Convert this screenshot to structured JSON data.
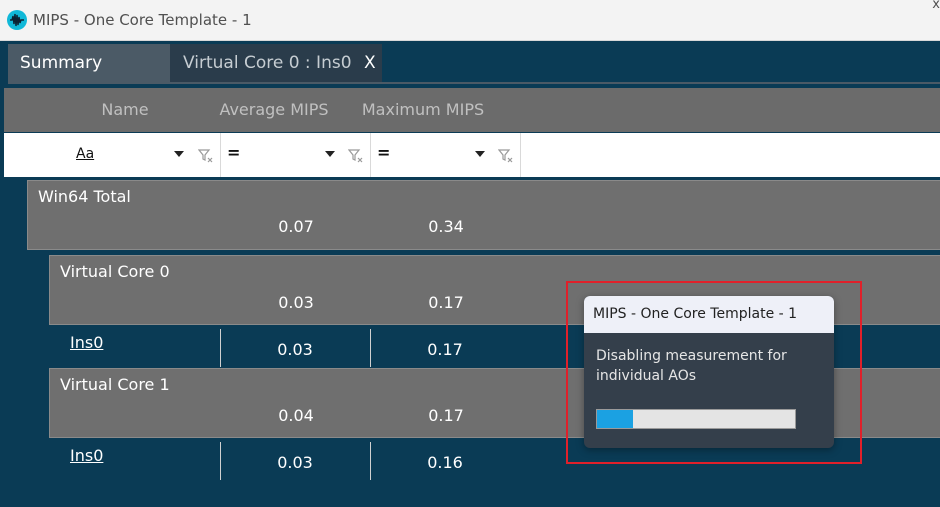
{
  "window": {
    "title": "MIPS - One Core Template - 1",
    "close_glyph": "x"
  },
  "tabs": [
    {
      "label": "Summary",
      "selected": true
    },
    {
      "label": "Virtual Core 0 : Ins0",
      "close_label": "X",
      "selected": false
    }
  ],
  "table": {
    "columns": [
      "Name",
      "Average MIPS",
      "Maximum MIPS"
    ],
    "filters": [
      {
        "operator": "Aa"
      },
      {
        "operator": "="
      },
      {
        "operator": "="
      }
    ],
    "rows": [
      {
        "name": "Win64 Total",
        "average": "0.07",
        "maximum": "0.34"
      },
      {
        "name": "Virtual Core 0",
        "average": "0.03",
        "maximum": "0.17"
      },
      {
        "name": "Ins0",
        "average": "0.03",
        "maximum": "0.17"
      },
      {
        "name": "Virtual Core 1",
        "average": "0.04",
        "maximum": "0.17"
      },
      {
        "name": "Ins0",
        "average": "0.03",
        "maximum": "0.16"
      }
    ]
  },
  "popup": {
    "title": "MIPS - One Core Template - 1",
    "message": "Disabling measurement for individual AOs",
    "progress": 0.18
  },
  "colors": {
    "background": "#0a3b55",
    "accent": "#1ba1e2",
    "highlight": "#e0202a"
  }
}
